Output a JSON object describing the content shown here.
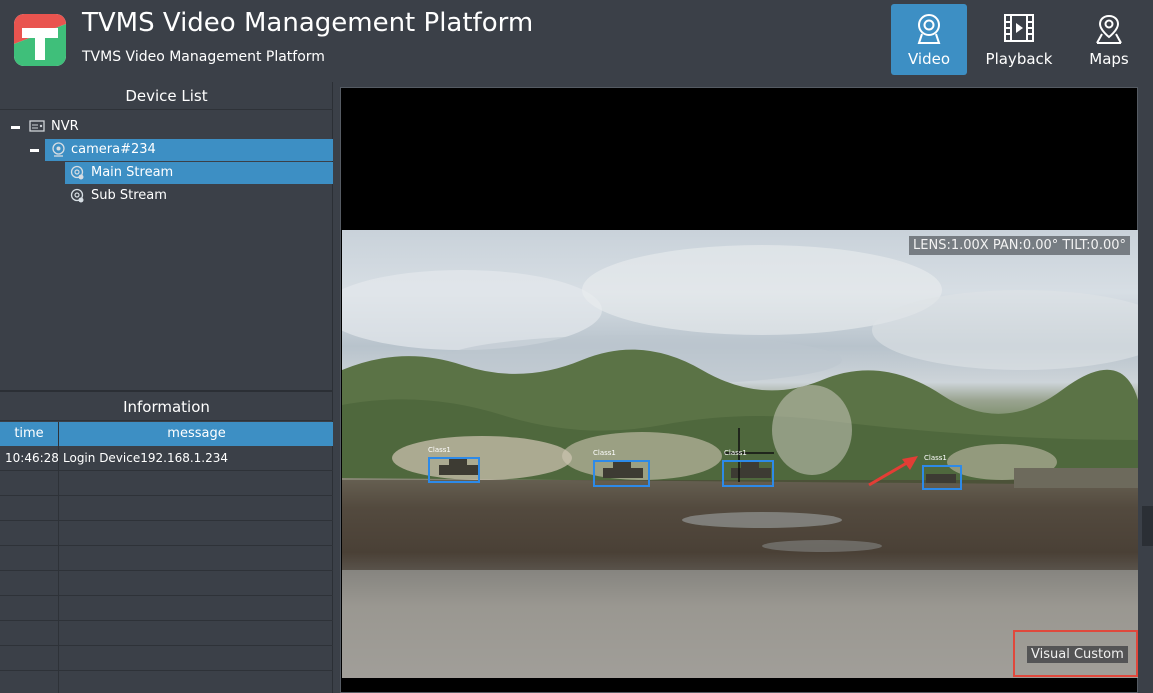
{
  "header": {
    "title": "TVMS Video Management Platform",
    "subtitle": "TVMS Video Management Platform",
    "logo_icon": "tvms-logo-icon",
    "nav": [
      {
        "label": "Video",
        "icon": "webcam-icon",
        "active": true
      },
      {
        "label": "Playback",
        "icon": "film-icon",
        "active": false
      },
      {
        "label": "Maps",
        "icon": "map-pin-icon",
        "active": false
      }
    ]
  },
  "device_list": {
    "title": "Device List",
    "tree": [
      {
        "label": "NVR",
        "icon": "nvr-icon",
        "level": 0,
        "expanded": true
      },
      {
        "label": "camera#234",
        "icon": "camera-icon",
        "level": 1,
        "expanded": true,
        "selected": true
      },
      {
        "label": "Main Stream",
        "icon": "stream-icon",
        "level": 2,
        "selected": true
      },
      {
        "label": "Sub Stream",
        "icon": "stream-icon",
        "level": 2,
        "selected": false
      }
    ]
  },
  "information": {
    "title": "Information",
    "columns": [
      "time",
      "message"
    ],
    "rows": [
      {
        "time": "10:46:28",
        "message": "Login Device192.168.1.234"
      }
    ]
  },
  "video": {
    "ptz_readout": "LENS:1.00X  PAN:0.00°  TILT:0.00°",
    "detections": [
      {
        "label": "Class1"
      },
      {
        "label": "Class1"
      },
      {
        "label": "Class1"
      },
      {
        "label": "Class1"
      }
    ],
    "overlay_button": "Visual Custom"
  },
  "colors": {
    "background": "#3b4048",
    "accent": "#3d8fc4",
    "detection_box": "#2d8ae8",
    "highlight_border": "#e0483c"
  }
}
